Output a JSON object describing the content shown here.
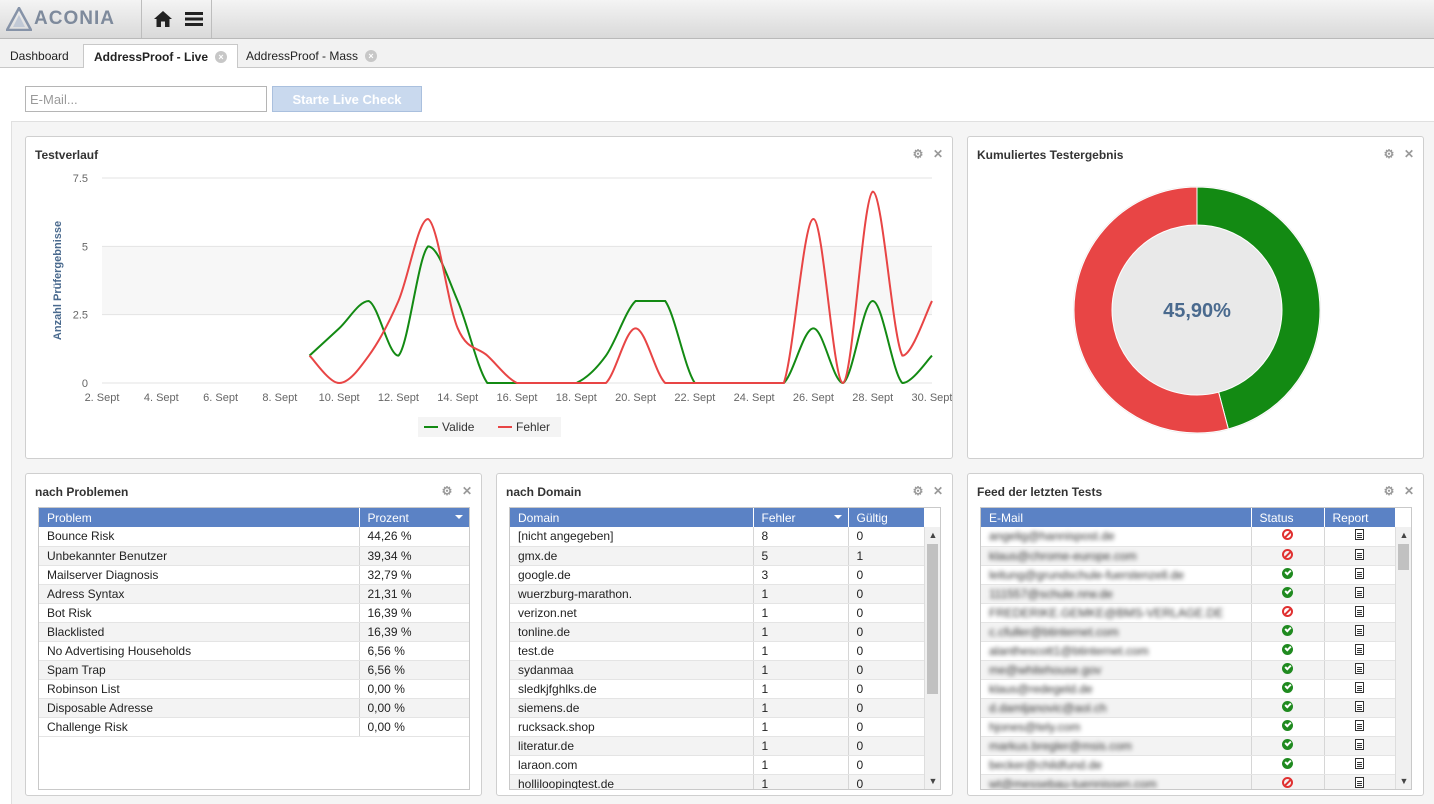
{
  "app": {
    "logo_text": "ACONIA",
    "logo_prefix": "A"
  },
  "tabs": [
    {
      "label": "Dashboard",
      "active": false,
      "closable": false
    },
    {
      "label": "AddressProof - Live",
      "active": true,
      "closable": true
    },
    {
      "label": "AddressProof - Mass",
      "active": false,
      "closable": true
    }
  ],
  "live_check": {
    "placeholder": "E-Mail...",
    "button_label": "Starte Live Check"
  },
  "panels": {
    "testverlauf": {
      "title": "Testverlauf"
    },
    "kumuliert": {
      "title": "Kumuliertes Testergebnis",
      "center_label": "45,90%"
    },
    "probleme": {
      "title": "nach Problemen"
    },
    "domain": {
      "title": "nach Domain"
    },
    "feed": {
      "title": "Feed der letzten Tests"
    }
  },
  "colors": {
    "valid": "#138a13",
    "error": "#e84545",
    "header": "#5b82c5",
    "accent_text": "#4a6a8e"
  },
  "chart_data": [
    {
      "type": "line",
      "title": "Testverlauf",
      "ylabel": "Anzahl Prüfergebnisse",
      "ylim": [
        0,
        7.5
      ],
      "yticks": [
        "0",
        "2.5",
        "5",
        "7.5"
      ],
      "xticks": [
        "2. Sept",
        "4. Sept",
        "6. Sept",
        "8. Sept",
        "10. Sept",
        "12. Sept",
        "14. Sept",
        "16. Sept",
        "18. Sept",
        "20. Sept",
        "22. Sept",
        "24. Sept",
        "26. Sept",
        "28. Sept",
        "30. Sept"
      ],
      "x": [
        9,
        10,
        11,
        12,
        13,
        14,
        15,
        16,
        17,
        18,
        19,
        20,
        21,
        22,
        23,
        24,
        25,
        26,
        27,
        28,
        29,
        30
      ],
      "series": [
        {
          "name": "Valide",
          "color": "#138a13",
          "values": [
            1,
            2,
            3,
            1,
            5,
            3,
            0,
            0,
            0,
            0,
            1,
            3,
            3,
            0,
            0,
            0,
            0,
            2,
            0,
            3,
            0,
            1
          ]
        },
        {
          "name": "Fehler",
          "color": "#e84545",
          "values": [
            1,
            0,
            1,
            3,
            6,
            2,
            1,
            0,
            0,
            0,
            0,
            2,
            0,
            0,
            0,
            0,
            0,
            6,
            0,
            7,
            1,
            3
          ]
        }
      ],
      "legend": "bottom-center"
    },
    {
      "type": "pie",
      "title": "Kumuliertes Testergebnis",
      "center_label": "45,90%",
      "slices": [
        {
          "name": "Valide",
          "value": 45.9,
          "color": "#138a13"
        },
        {
          "name": "Fehler",
          "value": 54.1,
          "color": "#e84545"
        }
      ]
    }
  ],
  "probleme_table": {
    "columns": [
      "Problem",
      "Prozent"
    ],
    "rows": [
      [
        "Bounce Risk",
        "44,26 %"
      ],
      [
        "Unbekannter Benutzer",
        "39,34 %"
      ],
      [
        "Mailserver Diagnosis",
        "32,79 %"
      ],
      [
        "Adress Syntax",
        "21,31 %"
      ],
      [
        "Bot Risk",
        "16,39 %"
      ],
      [
        "Blacklisted",
        "16,39 %"
      ],
      [
        "No Advertising Households",
        "6,56 %"
      ],
      [
        "Spam Trap",
        "6,56 %"
      ],
      [
        "Robinson List",
        "0,00 %"
      ],
      [
        "Disposable Adresse",
        "0,00 %"
      ],
      [
        "Challenge Risk",
        "0,00 %"
      ]
    ]
  },
  "domain_table": {
    "columns": [
      "Domain",
      "Fehler",
      "Gültig"
    ],
    "rows": [
      [
        "[nicht angegeben]",
        "8",
        "0"
      ],
      [
        "gmx.de",
        "5",
        "1"
      ],
      [
        "google.de",
        "3",
        "0"
      ],
      [
        "wuerzburg-marathon.",
        "1",
        "0"
      ],
      [
        "verizon.net",
        "1",
        "0"
      ],
      [
        "tonline.de",
        "1",
        "0"
      ],
      [
        "test.de",
        "1",
        "0"
      ],
      [
        "sydanmaa",
        "1",
        "0"
      ],
      [
        "sledkjfghlks.de",
        "1",
        "0"
      ],
      [
        "siemens.de",
        "1",
        "0"
      ],
      [
        "rucksack.shop",
        "1",
        "0"
      ],
      [
        "literatur.de",
        "1",
        "0"
      ],
      [
        "laraon.com",
        "1",
        "0"
      ],
      [
        "holliloopingtest.de",
        "1",
        "0"
      ]
    ]
  },
  "feed_table": {
    "columns": [
      "E-Mail",
      "Status",
      "Report"
    ],
    "rows": [
      [
        "angelig@hannispost.de",
        "error"
      ],
      [
        "klaus@chrome-europe.com",
        "error"
      ],
      [
        "leitung@grundschule-fuerstenzell.de",
        "ok"
      ],
      [
        "111557@schule.nrw.de",
        "ok"
      ],
      [
        "FREDERIKE.GEMKE@BMS-VERLAGE.DE",
        "error"
      ],
      [
        "c.cfuller@btinternet.com",
        "ok"
      ],
      [
        "alanthescott1@btinternet.com",
        "ok"
      ],
      [
        "me@whitehouse.gov",
        "ok"
      ],
      [
        "klaus@redegeld.de",
        "ok"
      ],
      [
        "d.damljanovic@aol.ch",
        "ok"
      ],
      [
        "hjones@tely.com",
        "ok"
      ],
      [
        "markus.bregler@msis.com",
        "ok"
      ],
      [
        "becker@childfund.de",
        "ok"
      ],
      [
        "wt@messebau-tuennissen.com",
        "error"
      ]
    ]
  }
}
